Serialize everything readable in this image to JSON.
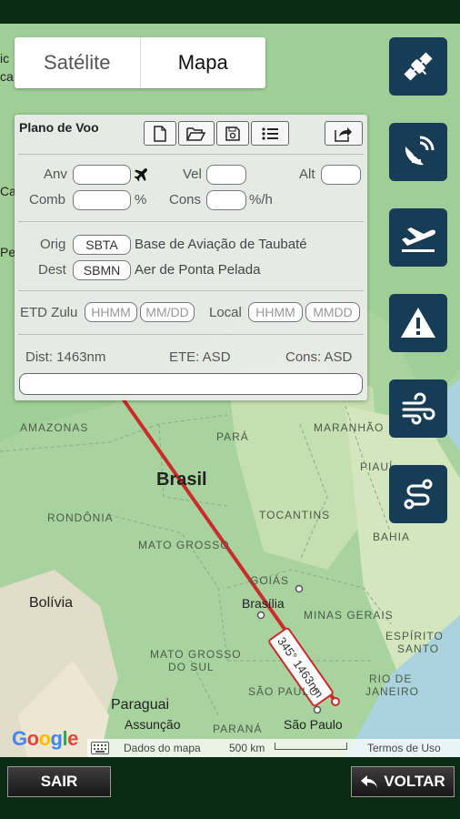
{
  "map_type": {
    "satellite": "Satélite",
    "map": "Mapa"
  },
  "plan": {
    "title": "Plano de Voo",
    "anv_label": "Anv",
    "vel_label": "Vel",
    "alt_label": "Alt",
    "comb_label": "Comb",
    "comb_unit": "%",
    "cons_label": "Cons",
    "cons_unit": "%/h",
    "orig_label": "Orig",
    "orig_code": "SBTA",
    "orig_name": "Base de Aviação de Taubaté",
    "dest_label": "Dest",
    "dest_code": "SBMN",
    "dest_name": "Aer de Ponta Pelada",
    "etd_label": "ETD Zulu",
    "etd_time_placeholder": "HHMM",
    "etd_date_placeholder": "MM/DD",
    "local_label": "Local",
    "local_time_placeholder": "HHMM",
    "local_date_placeholder": "MMDD",
    "dist": "Dist: 1463nm",
    "ete": "ETE: ASD",
    "cons": "Cons: ASD"
  },
  "route": {
    "label": "345° 1463nm"
  },
  "map_labels": {
    "amazonas": "AMAZONAS",
    "para": "PARÁ",
    "maranhao": "MARANHÃO",
    "piaui": "PIAUÍ",
    "brasil": "Brasil",
    "rondonia": "RONDÔNIA",
    "tocantins": "TOCANTINS",
    "bahia": "BAHIA",
    "mato_grosso": "MATO GROSSO",
    "goias": "GOIÁS",
    "bolivia": "Bolívia",
    "brasilia": "Brasília",
    "minas_gerais": "MINAS GERAIS",
    "espirito_santo_1": "ESPÍRITO",
    "espirito_santo_2": "SANTO",
    "mato_grosso_sul_1": "MATO GROSSO",
    "mato_grosso_sul_2": "DO SUL",
    "rio_1": "RIO DE",
    "rio_2": "JANEIRO",
    "sao_paulo_state": "SÃO PAULO",
    "paraguai": "Paraguai",
    "assuncao": "Assunção",
    "sao_paulo": "São Paulo",
    "parana": "PARANÁ",
    "edge_1": "ic",
    "edge_2": "ca",
    "edge_3": "Ca",
    "edge_4": "Pe"
  },
  "attribution": {
    "google": "Google",
    "data": "Dados do mapa",
    "scale": "500 km",
    "terms": "Termos de Uso"
  },
  "side_icons": [
    "satellite-icon",
    "radar-icon",
    "takeoff-icon",
    "warning-icon",
    "wind-icon",
    "route-icon"
  ],
  "buttons": {
    "exit": "SAIR",
    "back": "VOLTAR"
  }
}
